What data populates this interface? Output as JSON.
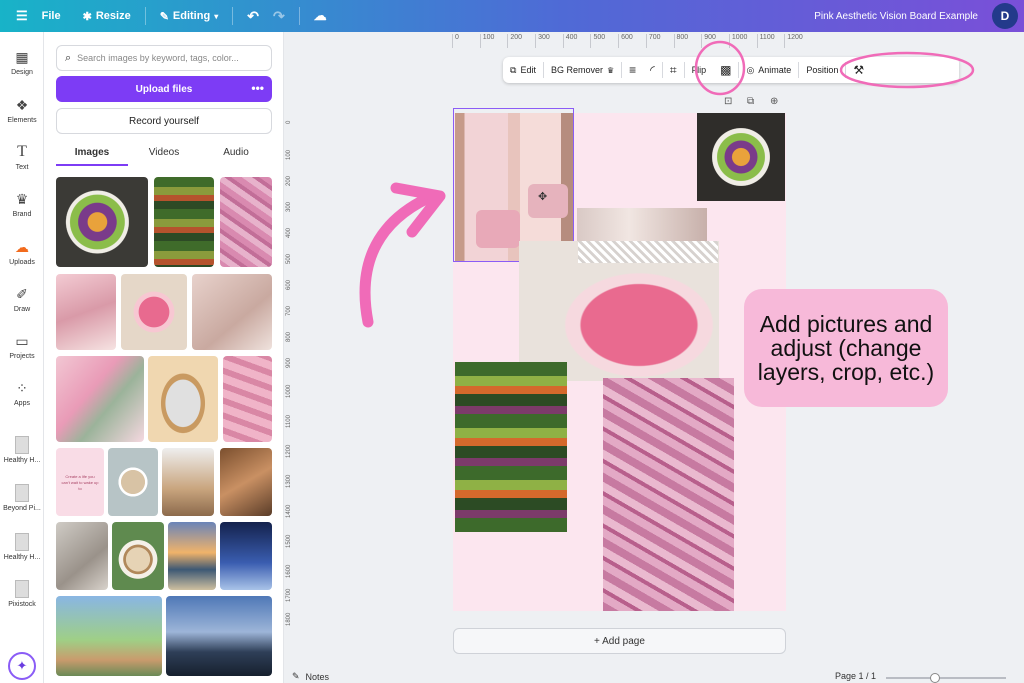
{
  "topbar": {
    "menu_icon": "hamburger-icon",
    "file_label": "File",
    "resize_label": "Resize",
    "editing_label": "Editing",
    "doc_title": "Pink Aesthetic Vision Board Example",
    "avatar_initial": "D"
  },
  "rail": {
    "items": [
      {
        "label": "Design",
        "icon": "design-icon"
      },
      {
        "label": "Elements",
        "icon": "elements-icon"
      },
      {
        "label": "Text",
        "icon": "text-icon"
      },
      {
        "label": "Brand",
        "icon": "brand-icon"
      },
      {
        "label": "Uploads",
        "icon": "uploads-icon"
      },
      {
        "label": "Draw",
        "icon": "draw-icon"
      },
      {
        "label": "Projects",
        "icon": "projects-icon"
      },
      {
        "label": "Apps",
        "icon": "apps-icon"
      },
      {
        "label": "Healthy H...",
        "icon": "recent-design-thumb"
      },
      {
        "label": "Beyond Pi...",
        "icon": "recent-design-thumb"
      },
      {
        "label": "Healthy H...",
        "icon": "recent-design-thumb"
      },
      {
        "label": "Pixistock",
        "icon": "pixistock-icon"
      }
    ]
  },
  "panel": {
    "search_placeholder": "Search images by keyword, tags, color...",
    "upload_label": "Upload files",
    "upload_more": "•••",
    "record_label": "Record yourself",
    "tabs": [
      "Images",
      "Videos",
      "Audio"
    ],
    "active_tab": "Images"
  },
  "ruler": {
    "top": [
      "0",
      "100",
      "200",
      "300",
      "400",
      "500",
      "600",
      "700",
      "800",
      "900",
      "1000",
      "1100",
      "1200"
    ],
    "left": [
      "0",
      "100",
      "200",
      "300",
      "400",
      "500",
      "600",
      "700",
      "800",
      "900",
      "1000",
      "1100",
      "1200",
      "1300",
      "1400",
      "1500",
      "1600",
      "1700",
      "1800"
    ]
  },
  "toolbar": {
    "edit": "Edit",
    "bg_remover": "BG Remover",
    "flip": "Flip",
    "animate": "Animate",
    "position": "Position"
  },
  "canvas": {
    "add_page": "+ Add page",
    "callout_text": "Add pictures and adjust (change layers, crop, etc.)"
  },
  "bottom": {
    "notes": "Notes",
    "page_indicator": "Page 1 / 1"
  },
  "colors": {
    "accent": "#7d3cf5",
    "annotation_pink": "#f06bb8",
    "page_bg": "#fce6ef"
  }
}
